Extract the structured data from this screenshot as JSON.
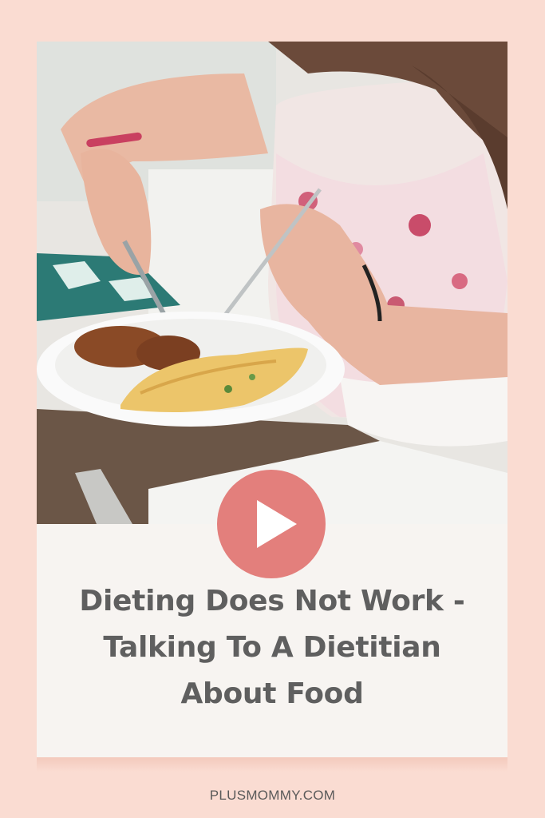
{
  "pin": {
    "title_lines": [
      "Dieting Does Not Work -",
      "Talking To A Dietitian",
      "About Food"
    ],
    "footer": "PLUSMOMMY.COM",
    "icons": {
      "play": "play-icon"
    },
    "colors": {
      "background": "#fadcd2",
      "card": "#f7f4f1",
      "play_button": "#e37f7c",
      "title_text": "#5f5f5f"
    }
  }
}
